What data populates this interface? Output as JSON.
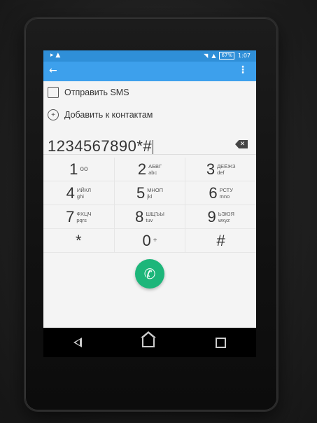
{
  "status": {
    "time": "1:07",
    "battery": "67%"
  },
  "actions": {
    "send_sms": "Отправить SMS",
    "add_contact": "Добавить к контактам"
  },
  "dialer": {
    "number": "1234567890*#",
    "keys": [
      {
        "digit": "1",
        "top": "ᴏᴏ",
        "bottom": ""
      },
      {
        "digit": "2",
        "top": "АБВГ",
        "bottom": "abc"
      },
      {
        "digit": "3",
        "top": "ДЕЁЖЗ",
        "bottom": "def"
      },
      {
        "digit": "4",
        "top": "ИЙКЛ",
        "bottom": "ghi"
      },
      {
        "digit": "5",
        "top": "МНОП",
        "bottom": "jkl"
      },
      {
        "digit": "6",
        "top": "РСТУ",
        "bottom": "mno"
      },
      {
        "digit": "7",
        "top": "ФХЦЧ",
        "bottom": "pqrs"
      },
      {
        "digit": "8",
        "top": "ШЩЪЫ",
        "bottom": "tuv"
      },
      {
        "digit": "9",
        "top": "ЬЭЮЯ",
        "bottom": "wxyz"
      },
      {
        "digit": "*",
        "top": "",
        "bottom": ""
      },
      {
        "digit": "0",
        "top": "+",
        "bottom": ""
      },
      {
        "digit": "#",
        "top": "",
        "bottom": ""
      }
    ]
  },
  "colors": {
    "statusbar": "#2f8fd8",
    "appbar": "#3da0ec",
    "call_button": "#1db67a"
  }
}
